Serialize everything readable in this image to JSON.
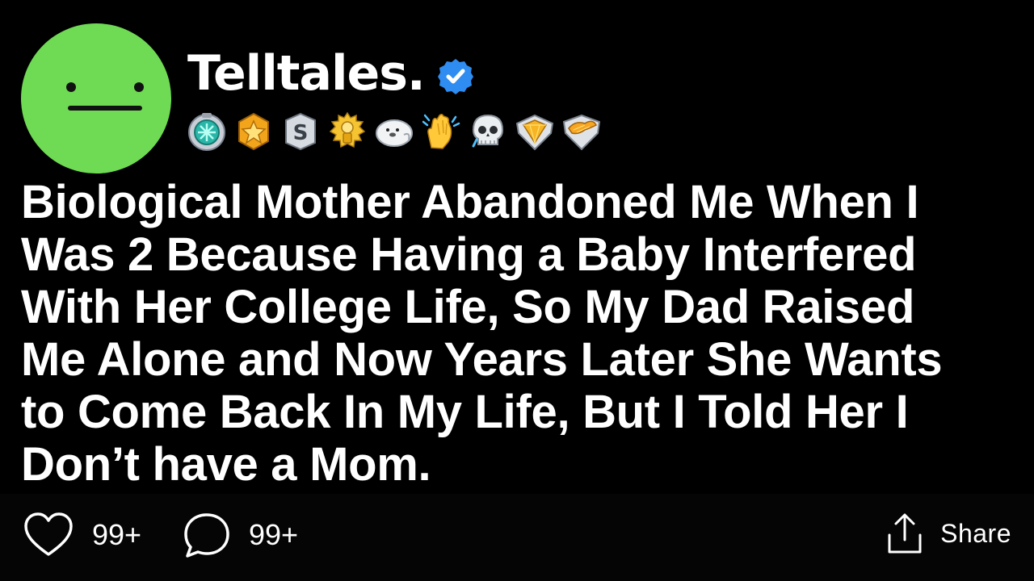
{
  "author": {
    "name": "Telltales.",
    "verified": true,
    "avatar_color": "#6fda53",
    "avatar_icon": "neutral-face"
  },
  "badges": [
    {
      "name": "diamond-gear-badge-icon"
    },
    {
      "name": "gold-star-badge-icon"
    },
    {
      "name": "silver-s-badge-icon"
    },
    {
      "name": "gold-trophy-badge-icon"
    },
    {
      "name": "seal-badge-icon"
    },
    {
      "name": "clapping-hands-badge-icon"
    },
    {
      "name": "skull-badge-icon"
    },
    {
      "name": "gold-gem-badge-icon"
    },
    {
      "name": "gold-wings-badge-icon"
    }
  ],
  "post": {
    "title": "Biological Mother Abandoned Me When I\nWas 2 Because Having a Baby Interfered\nWith Her College Life, So My Dad Raised\nMe Alone and Now Years Later She Wants\nto Come Back In My Life, But I Told Her I\nDon’t have a Mom."
  },
  "actions": {
    "likes": "99+",
    "comments": "99+",
    "share_label": "Share"
  },
  "colors": {
    "background": "#000000",
    "text": "#ffffff",
    "verified_blue": "#2f8cf0"
  }
}
